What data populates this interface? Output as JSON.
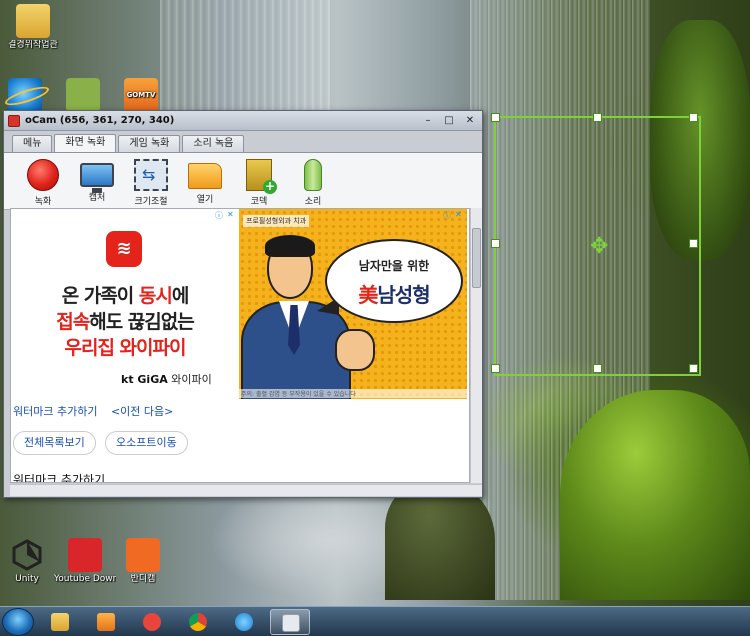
{
  "desktop_icons": [
    {
      "label": "결경위작업관"
    },
    {
      "label": ""
    },
    {
      "label": ""
    },
    {
      "label": "GOMTV"
    },
    {
      "label": "Unity"
    },
    {
      "label": "Youtube Downloade..."
    },
    {
      "label": "반디캠"
    }
  ],
  "window": {
    "title": "oCam (656, 361, 270, 340)",
    "tabs": [
      "메뉴",
      "화면 녹화",
      "게임 녹화",
      "소리 녹음"
    ],
    "active_tab": "화면 녹화",
    "tools": [
      "녹화",
      "캡처",
      "크기조절",
      "열기",
      "코덱",
      "소리"
    ]
  },
  "ad_left": {
    "line1_a": "온 가족이 ",
    "line1_b": "동시",
    "line1_c": "에",
    "line2_a": "접속",
    "line2_b": "해도 끊김없는",
    "line3": "우리집 와이파이",
    "brand_a": "kt GiGA",
    "brand_b": " 와이파이"
  },
  "ad_right": {
    "clinic": "프로필성형외과 치과",
    "bubble_line1": "남자만을 위한",
    "bubble_line2_a": "美",
    "bubble_line2_b": "남성형",
    "caption": "주의: 출혈 감염 등 부작용이 있을 수 있습니다"
  },
  "page": {
    "link1": "워터마크 추가하기",
    "link2": "<이전 다음>",
    "pill1": "전체목록보기",
    "pill2": "오소프트이동",
    "section_title": "워터마크 추가하기"
  },
  "colors": {
    "selection": "#7dd23a",
    "kt_red": "#e4231a",
    "ad_yellow": "#f6b21c"
  }
}
